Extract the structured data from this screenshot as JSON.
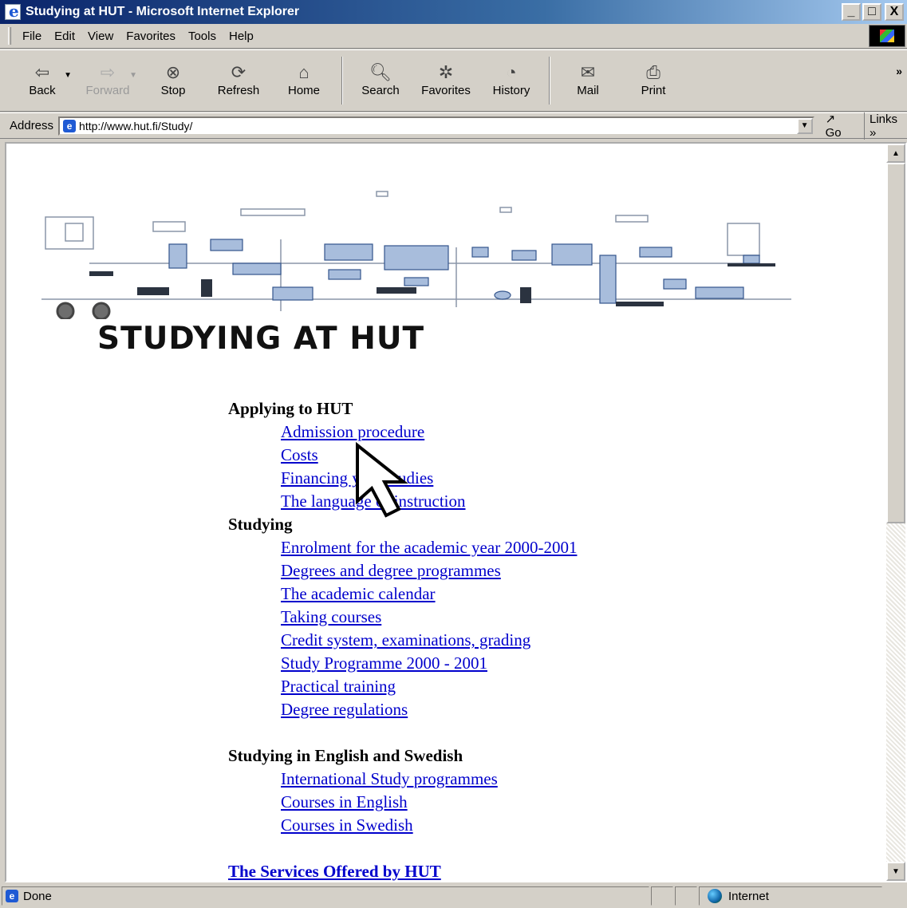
{
  "window": {
    "title": "Studying at HUT - Microsoft Internet Explorer",
    "minimize": "_",
    "maximize": "□",
    "close": "X"
  },
  "menu": [
    "File",
    "Edit",
    "View",
    "Favorites",
    "Tools",
    "Help"
  ],
  "toolbar": {
    "back": "Back",
    "forward": "Forward",
    "stop": "Stop",
    "refresh": "Refresh",
    "home": "Home",
    "search": "Search",
    "favorites": "Favorites",
    "history": "History",
    "mail": "Mail",
    "print": "Print",
    "more": "»"
  },
  "address": {
    "label": "Address",
    "url": "http://www.hut.fi/Study/",
    "go": "Go",
    "links": "Links »"
  },
  "page": {
    "heading": "STUDYING AT HUT",
    "sections": [
      {
        "title": "Applying to HUT",
        "links": [
          "Admission procedure",
          "Costs",
          "Financing your studies",
          "The language of instruction"
        ]
      },
      {
        "title": "Studying",
        "links": [
          "Enrolment for the academic year 2000-2001",
          "Degrees and degree programmes",
          "The academic calendar",
          "Taking courses",
          "Credit system, examinations, grading",
          "Study Programme 2000 - 2001",
          "Practical training",
          "Degree regulations"
        ]
      },
      {
        "title": "Studying in English and Swedish",
        "links": [
          "International Study programmes",
          "Courses in English",
          "Courses in Swedish"
        ]
      }
    ],
    "cut_off_link": "The Services Offered by HUT"
  },
  "status": {
    "text": "Done",
    "zone": "Internet"
  },
  "colors": {
    "link": "#0000cc",
    "titlebar_start": "#0a246a",
    "chrome": "#d4d0c8"
  },
  "icons": {
    "back": "back-arrow-icon",
    "forward": "forward-arrow-icon",
    "stop": "stop-icon",
    "refresh": "refresh-icon",
    "home": "home-icon",
    "search": "search-icon",
    "favorites": "favorites-icon",
    "history": "history-icon",
    "mail": "mail-icon",
    "print": "print-icon",
    "zone": "globe-icon"
  }
}
